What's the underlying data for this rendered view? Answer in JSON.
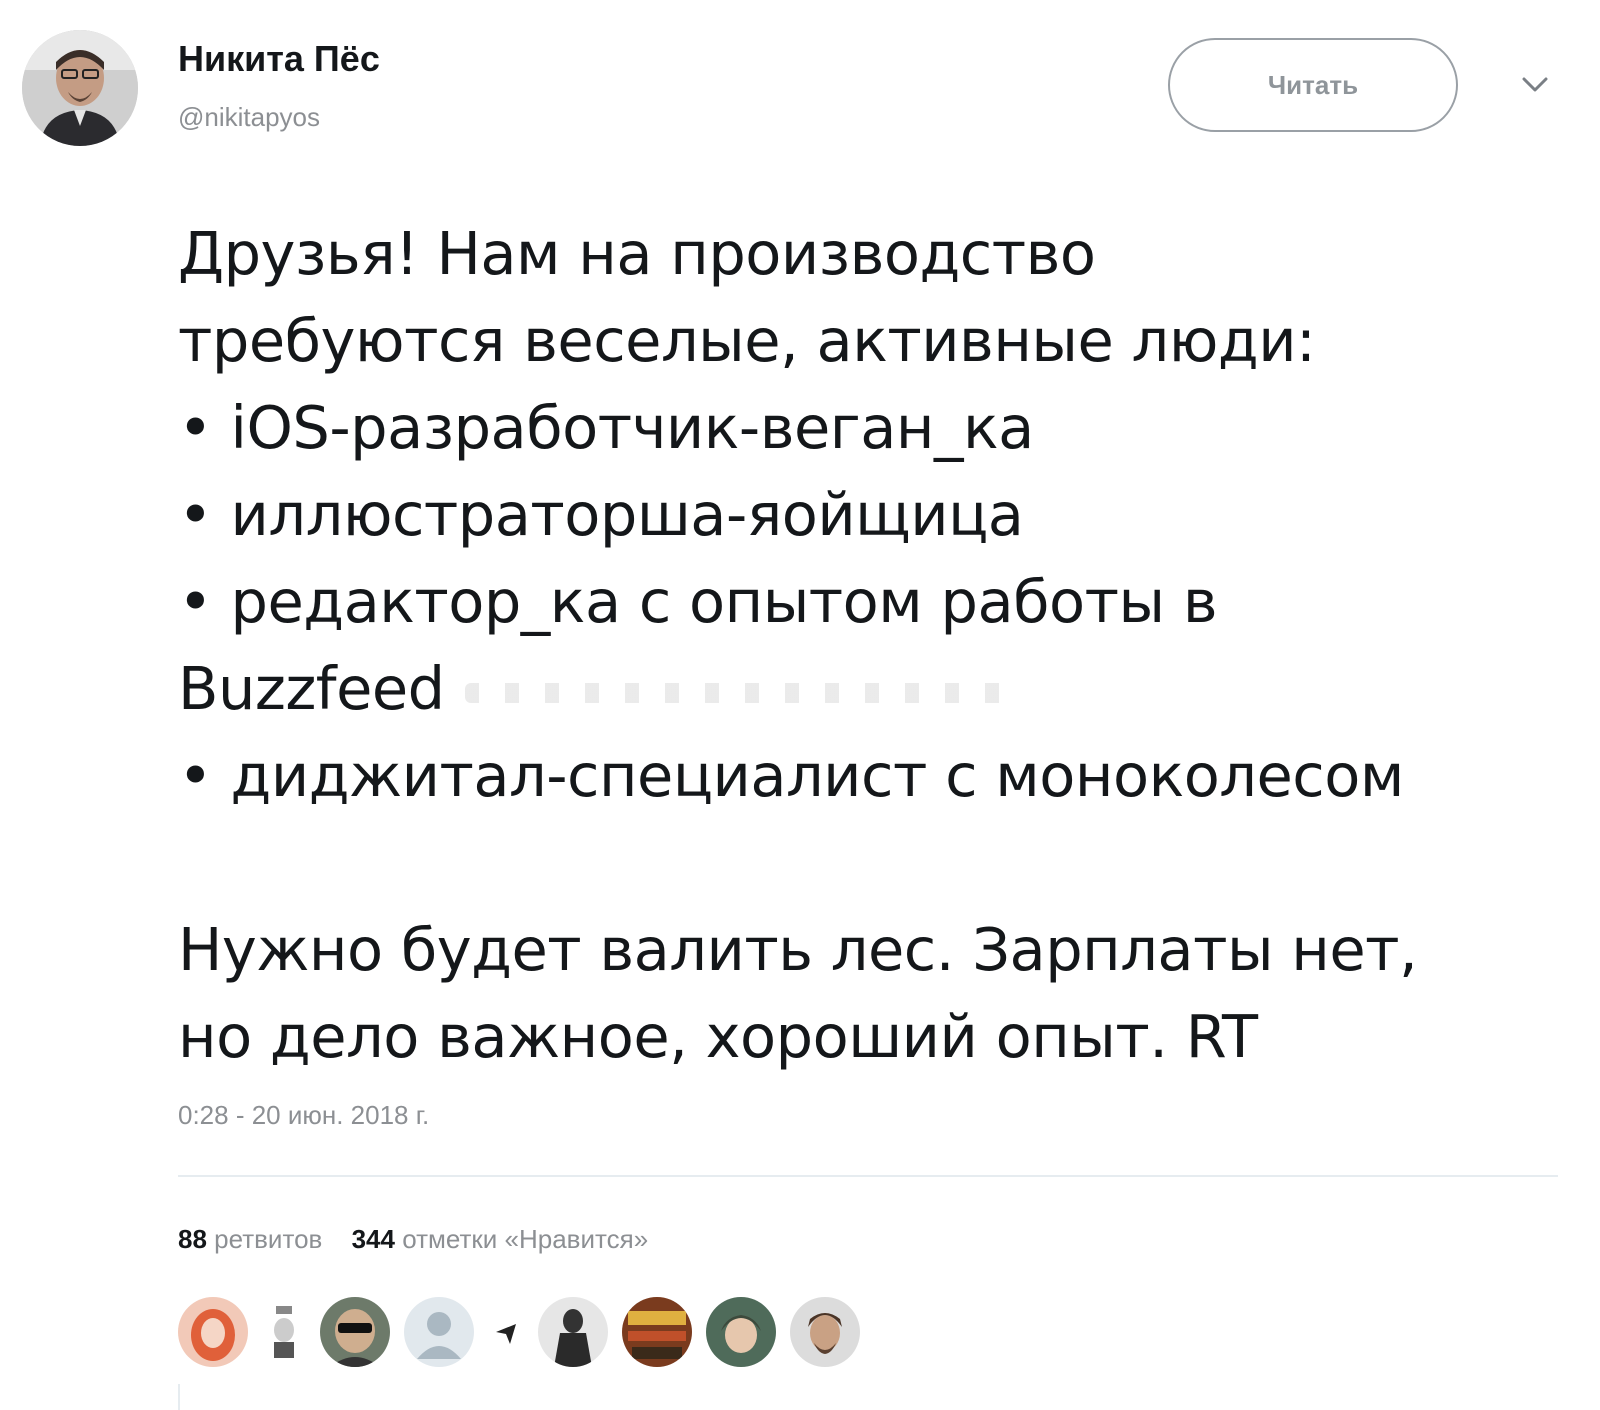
{
  "author": {
    "display_name": "Никита Пёс",
    "handle": "@nikitapyos"
  },
  "follow_button_label": "Читать",
  "tweet": {
    "lines": [
      "Друзья! Нам на производство",
      "требуются веселые, активные люди:",
      "• iOS-разработчик-веган_ка",
      "• иллюстраторша-яойщица",
      "• редактор_ка с опытом работы в",
      "Buzzfeed",
      "• диджитал-специалист с моноколесом",
      "",
      "Нужно будет валить лес. Зарплаты нет,",
      "но дело важное, хороший опыт. RT"
    ],
    "timestamp": "0:28 - 20 июн. 2018 г."
  },
  "stats": {
    "retweets_count": "88",
    "retweets_label": "ретвитов",
    "likes_count": "344",
    "likes_label": "отметки «Нравится»"
  },
  "icons": {
    "caret": "chevron-down-icon",
    "avatar": "avatar"
  },
  "colors": {
    "text": "#14171a",
    "secondary": "#8c8f93",
    "border": "#9aa0a6",
    "divider": "#e6ecf0"
  }
}
